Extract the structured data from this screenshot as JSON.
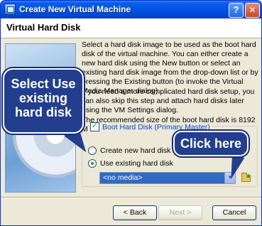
{
  "window": {
    "title": "Create New Virtual Machine",
    "help_label": "?",
    "close_label": "✕"
  },
  "header": {
    "title": "Virtual Hard Disk"
  },
  "description": {
    "para1": "Select a hard disk image to be used as the boot hard disk of the virtual machine. You can either create a new hard disk using the New button or select an existing hard disk image from the drop-down list or by pressing the Existing button (to invoke the Virtual Media Manager dialog).",
    "para2": "If you need a more complicated hard disk setup, you can also skip this step and attach hard disks later using the VM Settings dialog.",
    "para3": "The recommended size of the boot hard disk is 8192 MB."
  },
  "boot_disk": {
    "label": "Boot Hard Disk (Primary Master)",
    "checked": true,
    "options": [
      {
        "label": "Create new hard disk",
        "selected": false
      },
      {
        "label": "Use existing hard disk",
        "selected": true
      }
    ],
    "media_value": "<no media>"
  },
  "buttons": {
    "back": "< Back",
    "next": "Next >",
    "cancel": "Cancel"
  },
  "callouts": {
    "select_use": "Select Use existing hard disk",
    "click_here": "Click here"
  },
  "colors": {
    "callout_bg": "#223e8d",
    "title_bar": "#0055e5",
    "selection": "#316ac5"
  },
  "icons": [
    "app-icon",
    "help-icon",
    "close-icon",
    "dropdown-arrow-icon",
    "folder-icon"
  ]
}
